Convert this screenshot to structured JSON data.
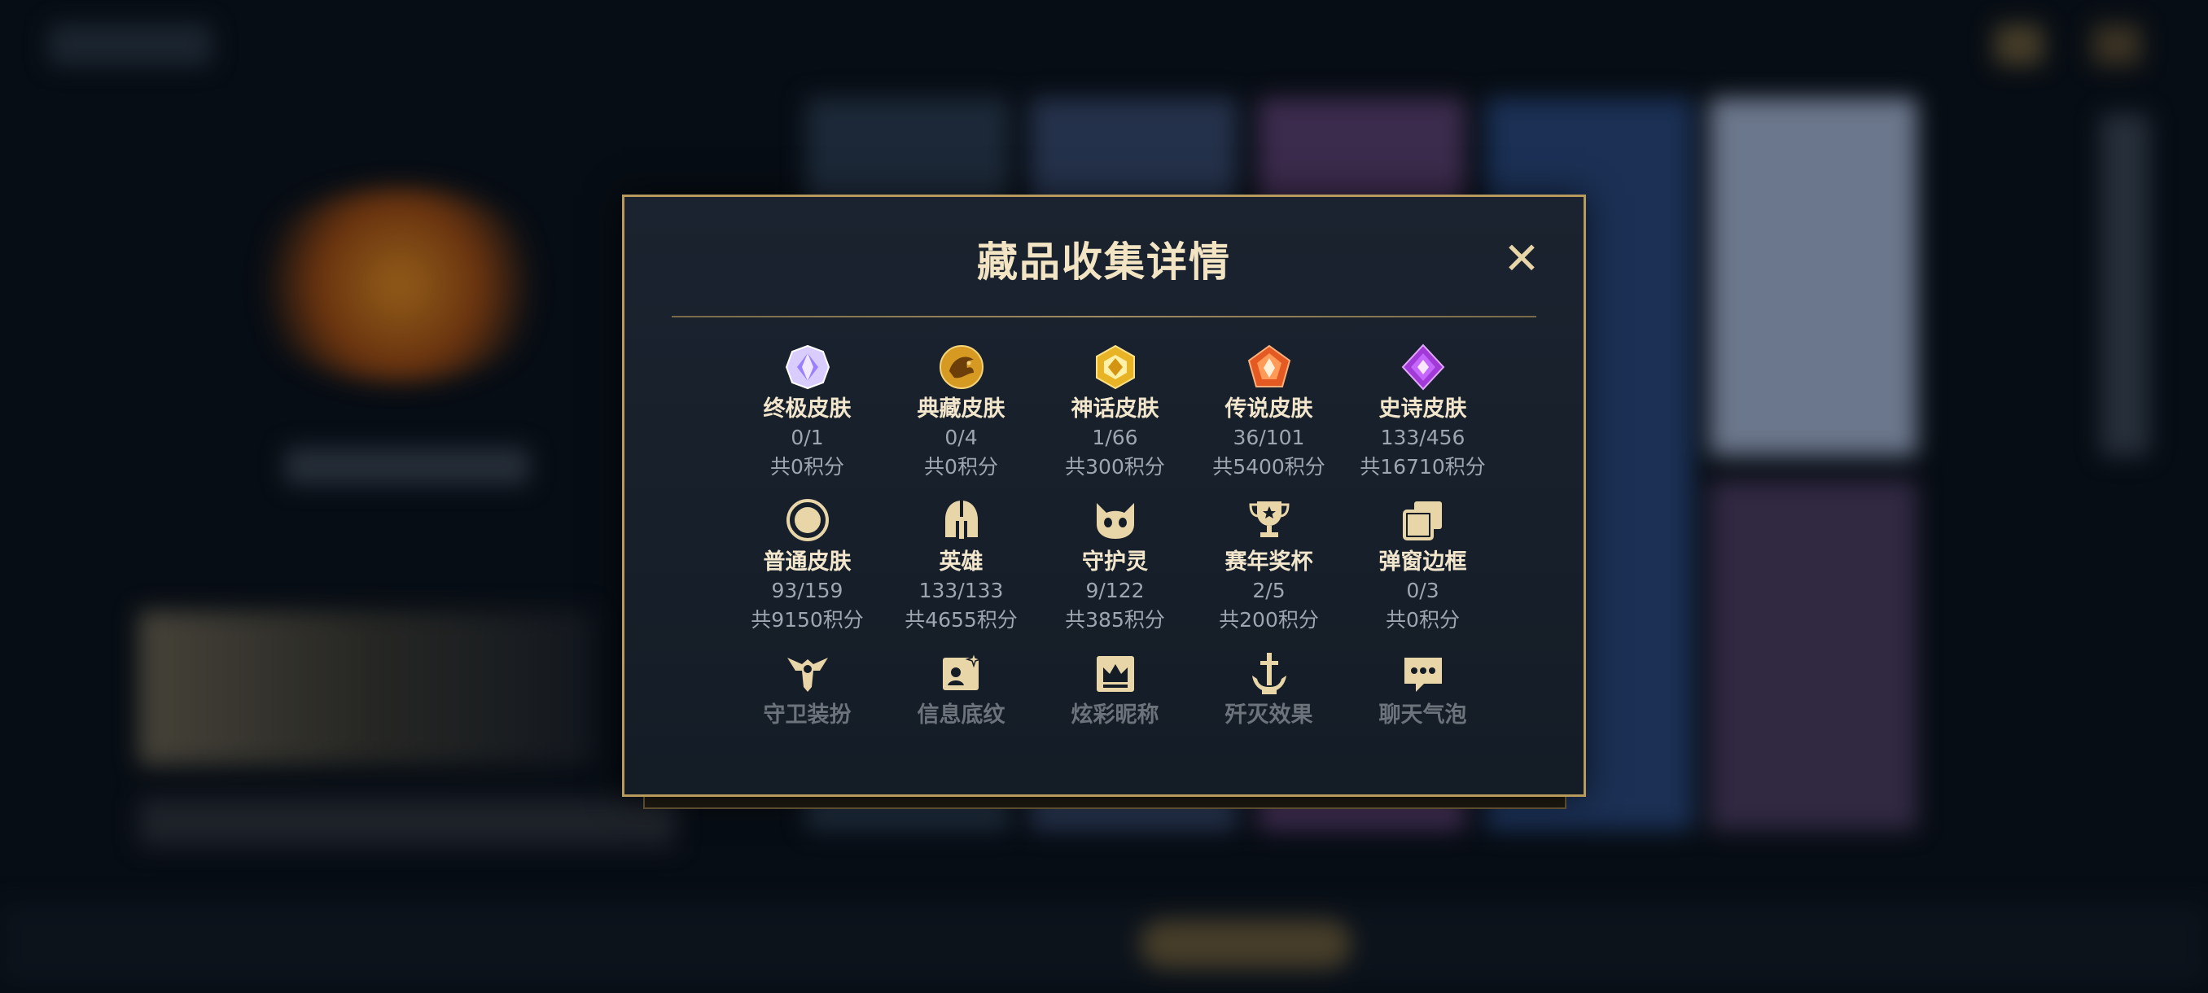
{
  "modal": {
    "title": "藏品收集详情",
    "close_symbol": "✕",
    "items": [
      {
        "name": "终极皮肤",
        "count": "0/1",
        "points": "共0积分",
        "icon": "ultimate-skin-icon",
        "color": "#c8b4ff"
      },
      {
        "name": "典藏皮肤",
        "count": "0/4",
        "points": "共0积分",
        "icon": "collector-skin-icon",
        "color": "#e0a92e"
      },
      {
        "name": "神话皮肤",
        "count": "1/66",
        "points": "共300积分",
        "icon": "mythic-skin-icon",
        "color": "#f1c232"
      },
      {
        "name": "传说皮肤",
        "count": "36/101",
        "points": "共5400积分",
        "icon": "legend-skin-icon",
        "color": "#f07a3a"
      },
      {
        "name": "史诗皮肤",
        "count": "133/456",
        "points": "共16710积分",
        "icon": "epic-skin-icon",
        "color": "#b34be8"
      },
      {
        "name": "普通皮肤",
        "count": "93/159",
        "points": "共9150积分",
        "icon": "normal-skin-icon",
        "color": "#e8d5a8"
      },
      {
        "name": "英雄",
        "count": "133/133",
        "points": "共4655积分",
        "icon": "hero-helmet-icon",
        "color": "#e8d5a8"
      },
      {
        "name": "守护灵",
        "count": "9/122",
        "points": "共385积分",
        "icon": "guardian-spirit-icon",
        "color": "#e8d5a8"
      },
      {
        "name": "赛年奖杯",
        "count": "2/5",
        "points": "共200积分",
        "icon": "season-trophy-icon",
        "color": "#e8d5a8"
      },
      {
        "name": "弹窗边框",
        "count": "0/3",
        "points": "共0积分",
        "icon": "popup-frame-icon",
        "color": "#e8d5a8"
      },
      {
        "name": "守卫装扮",
        "icon": "guard-outfit-icon",
        "color": "#e8d5a8"
      },
      {
        "name": "信息底纹",
        "icon": "info-background-icon",
        "color": "#e8d5a8"
      },
      {
        "name": "炫彩昵称",
        "icon": "colorful-nickname-icon",
        "color": "#e8d5a8"
      },
      {
        "name": "歼灭效果",
        "icon": "kill-effect-icon",
        "color": "#e8d5a8"
      },
      {
        "name": "聊天气泡",
        "icon": "chat-bubble-icon",
        "color": "#e8d5a8"
      }
    ]
  },
  "colors": {
    "accent": "#b89a5c",
    "title": "#f3e5c4",
    "muted": "#9ea6b1"
  }
}
